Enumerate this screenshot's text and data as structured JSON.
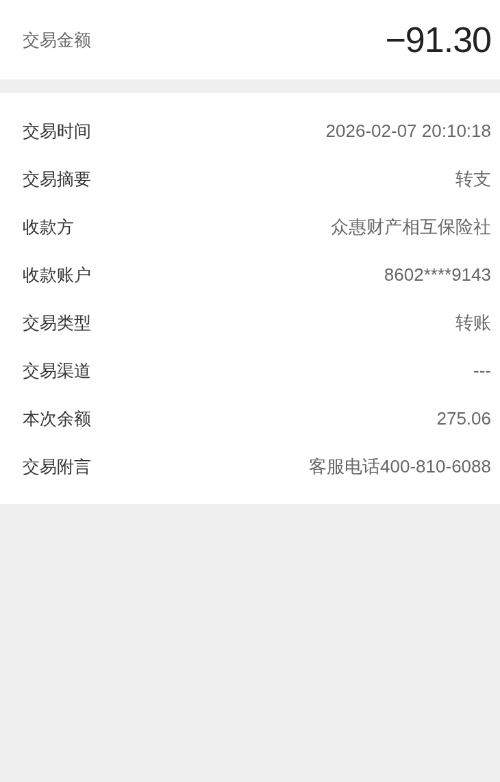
{
  "amount": {
    "label": "交易金额",
    "value": "−91.30"
  },
  "details": [
    {
      "label": "交易时间",
      "value": "2026-02-07 20:10:18"
    },
    {
      "label": "交易摘要",
      "value": "转支"
    },
    {
      "label": "收款方",
      "value": "众惠财产相互保险社"
    },
    {
      "label": "收款账户",
      "value": "8602****9143"
    },
    {
      "label": "交易类型",
      "value": "转账"
    },
    {
      "label": "交易渠道",
      "value": "---"
    },
    {
      "label": "本次余额",
      "value": "275.06"
    },
    {
      "label": "交易附言",
      "value": "客服电话400-810-6088"
    }
  ]
}
